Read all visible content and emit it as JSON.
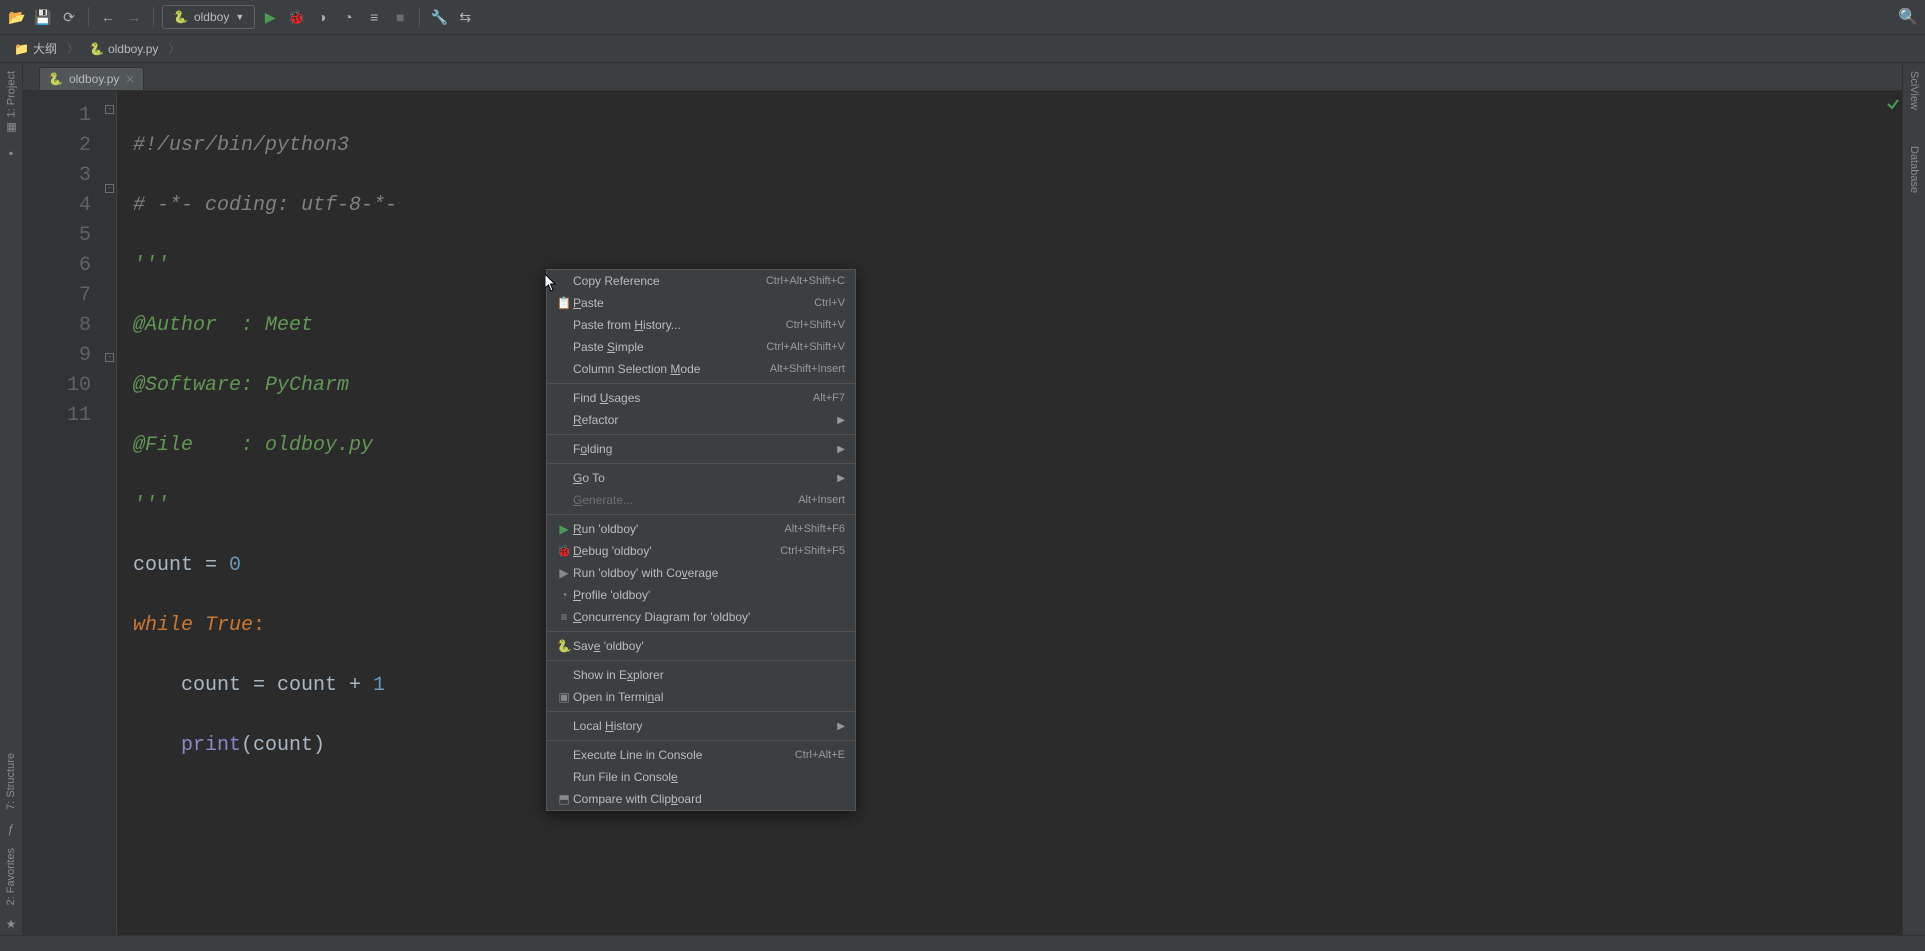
{
  "toolbar": {
    "run_config": "oldboy"
  },
  "breadcrumb": {
    "folder": "大纲",
    "file": "oldboy.py"
  },
  "tabs": {
    "active": "oldboy.py"
  },
  "gutter_lines": [
    "1",
    "2",
    "3",
    "4",
    "5",
    "6",
    "7",
    "8",
    "9",
    "10",
    "11"
  ],
  "code": {
    "l1_a": "#!/usr/bin/python3",
    "l2_a": "# -*- coding: utf-8-*-",
    "l3_a": "'''",
    "l4_a": "@Author  : Meet",
    "l5_a": "@Software: PyCharm",
    "l6_a": "@File    : oldboy.py",
    "l7_a": "'''",
    "l8_a": "count ",
    "l8_b": "= ",
    "l8_c": "0",
    "l9_a": "while ",
    "l9_b": "True",
    "l9_c": ":",
    "l10_a": "    count = count + ",
    "l10_b": "1",
    "l11_a": "    ",
    "l11_b": "print",
    "l11_c": "(count)"
  },
  "side": {
    "project": "1: Project",
    "structure": "7: Structure",
    "favorites": "2: Favorites",
    "sciview": "SciView",
    "database": "Database"
  },
  "context_menu": [
    {
      "type": "item",
      "label_html": "Copy Reference",
      "shortcut": "Ctrl+Alt+Shift+C",
      "icon": ""
    },
    {
      "type": "item",
      "label_html": "<u>P</u>aste",
      "shortcut": "Ctrl+V",
      "icon": "📋"
    },
    {
      "type": "item",
      "label_html": "Paste from <u>H</u>istory...",
      "shortcut": "Ctrl+Shift+V",
      "icon": ""
    },
    {
      "type": "item",
      "label_html": "Paste <u>S</u>imple",
      "shortcut": "Ctrl+Alt+Shift+V",
      "icon": ""
    },
    {
      "type": "item",
      "label_html": "Column Selection <u>M</u>ode",
      "shortcut": "Alt+Shift+Insert",
      "icon": ""
    },
    {
      "type": "sep"
    },
    {
      "type": "item",
      "label_html": "Find <u>U</u>sages",
      "shortcut": "Alt+F7",
      "icon": ""
    },
    {
      "type": "submenu",
      "label_html": "<u>R</u>efactor",
      "icon": ""
    },
    {
      "type": "sep"
    },
    {
      "type": "submenu",
      "label_html": "F<u>o</u>lding",
      "icon": ""
    },
    {
      "type": "sep"
    },
    {
      "type": "submenu",
      "label_html": "<u>G</u>o To",
      "icon": ""
    },
    {
      "type": "item",
      "label_html": "<u>G</u>enerate...",
      "shortcut": "Alt+Insert",
      "icon": "",
      "disabled": true
    },
    {
      "type": "sep"
    },
    {
      "type": "item",
      "label_html": "<u>R</u>un 'oldboy'",
      "shortcut": "Alt+Shift+F6",
      "icon": "▶",
      "iconcolor": "#499c54"
    },
    {
      "type": "item",
      "label_html": "<u>D</u>ebug 'oldboy'",
      "shortcut": "Ctrl+Shift+F5",
      "icon": "🐞",
      "iconcolor": "#499c54"
    },
    {
      "type": "item",
      "label_html": "Run 'oldboy' with Co<u>v</u>erage",
      "icon": "▶",
      "iconcolor": "#888888"
    },
    {
      "type": "item",
      "label_html": "<u>P</u>rofile 'oldboy'",
      "icon": "◔",
      "iconcolor": "#888888"
    },
    {
      "type": "item",
      "label_html": "<u>C</u>oncurrency Diagram for 'oldboy'",
      "icon": "≡",
      "iconcolor": "#888888"
    },
    {
      "type": "sep"
    },
    {
      "type": "item",
      "label_html": "Sav<u>e</u> 'oldboy'",
      "icon": "🐍",
      "iconcolor": "#d9a93a"
    },
    {
      "type": "sep"
    },
    {
      "type": "item",
      "label_html": "Show in E<u>x</u>plorer",
      "icon": ""
    },
    {
      "type": "item",
      "label_html": "Open in Termi<u>n</u>al",
      "icon": "▣",
      "iconcolor": "#888888"
    },
    {
      "type": "sep"
    },
    {
      "type": "submenu",
      "label_html": "Local <u>H</u>istory",
      "icon": ""
    },
    {
      "type": "sep"
    },
    {
      "type": "item",
      "label_html": "Execute Line in Console",
      "shortcut": "Ctrl+Alt+E",
      "icon": ""
    },
    {
      "type": "item",
      "label_html": "Run File in Consol<u>e</u>",
      "icon": ""
    },
    {
      "type": "item",
      "label_html": "Compare with Clip<u>b</u>oard",
      "icon": "⬒",
      "iconcolor": "#888888"
    }
  ]
}
